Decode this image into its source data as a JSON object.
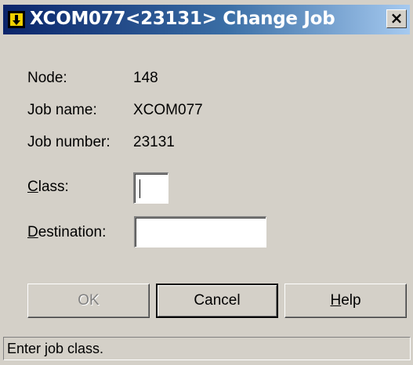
{
  "window": {
    "title": "XCOM077<23131> Change Job",
    "close_glyph": "×"
  },
  "fields": {
    "node_label": "Node:",
    "node_value": "148",
    "job_name_label": "Job name:",
    "job_name_value": "XCOM077",
    "job_number_label": "Job number:",
    "job_number_value": "23131",
    "class_label_mnemonic": "C",
    "class_label_rest": "lass:",
    "class_value": "",
    "destination_label_mnemonic": "D",
    "destination_label_rest": "estination:",
    "destination_value": ""
  },
  "buttons": {
    "ok_label": "OK",
    "cancel_label": "Cancel",
    "help_label_mnemonic": "H",
    "help_label_rest": "elp"
  },
  "status": {
    "text": "Enter job class."
  },
  "icons": {
    "app": "xcom-job-icon",
    "close": "close-icon"
  },
  "colors": {
    "title_gradient_start": "#0a246a",
    "title_gradient_end": "#a6caf0",
    "face": "#d4d0c8",
    "disabled_text": "#808080"
  }
}
